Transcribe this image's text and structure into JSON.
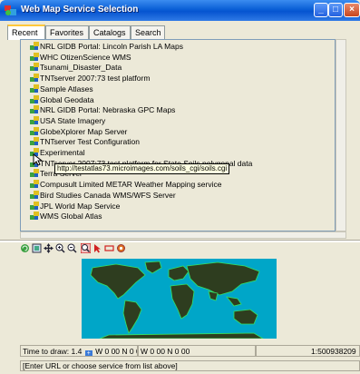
{
  "window": {
    "title": "Web Map Service Selection"
  },
  "tabs": [
    {
      "label": "Recent",
      "active": true
    },
    {
      "label": "Favorites",
      "active": false
    },
    {
      "label": "Catalogs",
      "active": false
    },
    {
      "label": "Search",
      "active": false
    }
  ],
  "services": [
    "NRL GIDB Portal: Lincoln Parish LA Maps",
    "WHC OtizenScience WMS",
    "Tsunami_Disaster_Data",
    "TNTserver 2007:73 test platform",
    "Sample Atlases",
    "Global Geodata",
    "NRL GIDB Portal: Nebraska GPC Maps",
    "USA State Imagery",
    "GlobeXplorer Map Server",
    "TNTserver Test Configuration",
    "Experimental",
    "TNTserver 2007:73 test platform for State Soils polygonal data",
    "Terra Server",
    "Compusult Limited METAR Weather Mapping service",
    "Bird Studies Canada WMS/WFS Server",
    "JPL World Map Service",
    "WMS Global Atlas"
  ],
  "tooltip": {
    "text": "http://testatlas73.microimages.com/soils_cgi/soils.cgi"
  },
  "icons": {
    "title": "window-icon",
    "service": "wms-service-icon",
    "tools": [
      "refresh-icon",
      "zoom-full-icon",
      "pan-icon",
      "zoom-in-icon",
      "zoom-out-icon",
      "zoom-box-icon",
      "select-arrow-icon",
      "rectangle-icon",
      "gear-icon"
    ]
  },
  "status": {
    "time_label": "Time to draw: 1.4",
    "coord_left": "W 0 00  N 0 00",
    "coord_center": "W 0 00  N 0 00",
    "scale": "1:500938209"
  },
  "message": "[Enter URL or choose service from list above]",
  "colors": {
    "titlebar": "#0a5fd6",
    "ocean": "#00a0c0",
    "land": "#2a3a1a",
    "tooltip_bg": "#ffffe1",
    "active_tab_top": "#ffc83c"
  }
}
